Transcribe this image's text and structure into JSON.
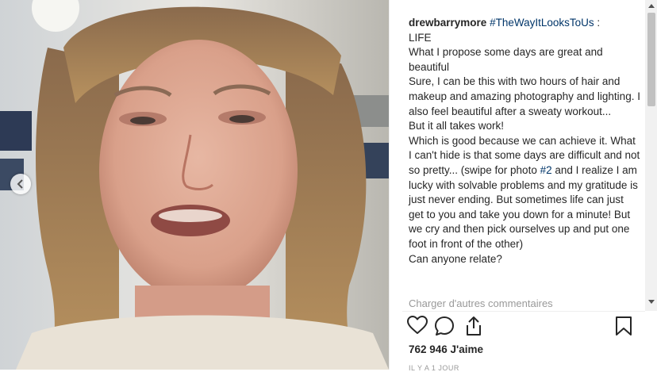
{
  "post": {
    "username": "drewbarrymore",
    "hashtag": "#TheWayItLooksToUs",
    "separator": " :",
    "caption_text": "\nLIFE\nWhat I propose some days are great and beautiful\nSure, I can be this with two hours of hair and makeup and amazing photography and lighting. I also feel beautiful after a sweaty workout...\nBut it all takes work!\nWhich is good because we can achieve it. What I can't hide is that some days are difficult and not so pretty... (swipe for photo ",
    "photo_tag": "#2",
    "caption_tail": " and I realize I am lucky with solvable problems and my gratitude is just never ending. But sometimes life can just get to you and take you down for a minute! But we cry and then pick ourselves up and put one foot in front of the other)\nCan anyone relate?",
    "more_comments": "Charger d'autres commentaires",
    "likes": "762 946 J'aime",
    "time": "IL Y A 1 JOUR"
  },
  "icons": [
    "chevron-left-icon",
    "heart-icon",
    "comment-icon",
    "share-icon",
    "bookmark-icon"
  ],
  "colors": {
    "hashtag": "#003569",
    "muted": "#999999",
    "text": "#262626"
  }
}
